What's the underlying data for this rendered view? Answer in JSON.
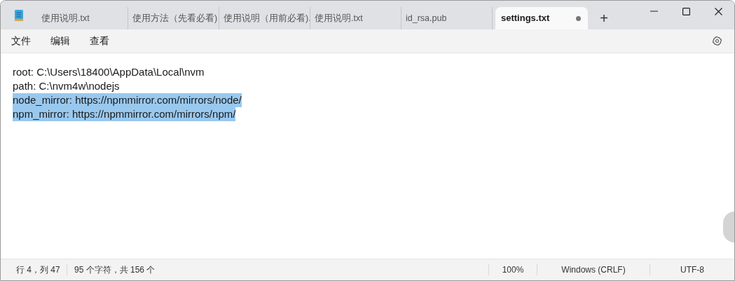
{
  "tabs": [
    {
      "label": "使用说明.txt",
      "selected": false,
      "modified": false
    },
    {
      "label": "使用方法（先看必看)",
      "selected": false,
      "modified": false
    },
    {
      "label": "使用说明（用前必看).",
      "selected": false,
      "modified": false
    },
    {
      "label": "使用说明.txt",
      "selected": false,
      "modified": false
    },
    {
      "label": "id_rsa.pub",
      "selected": false,
      "modified": false
    },
    {
      "label": "settings.txt",
      "selected": true,
      "modified": true
    }
  ],
  "new_tab": "+",
  "menu": [
    "文件",
    "编辑",
    "查看"
  ],
  "lines": [
    {
      "text": "root: C:\\Users\\18400\\AppData\\Local\\nvm",
      "selected": false
    },
    {
      "text": "path: C:\\nvm4w\\nodejs",
      "selected": false
    },
    {
      "text": "node_mirror: https://npmmirror.com/mirrors/node/",
      "selected": true
    },
    {
      "text": "npm_mirror: https://npmmirror.com/mirrors/npm/",
      "selected": true
    }
  ],
  "status_bar": {
    "position": "行 4，列 47",
    "count": "95 个字符，共 156 个",
    "zoom": "100%",
    "line_ending": "Windows (CRLF)",
    "encoding": "UTF-8"
  }
}
